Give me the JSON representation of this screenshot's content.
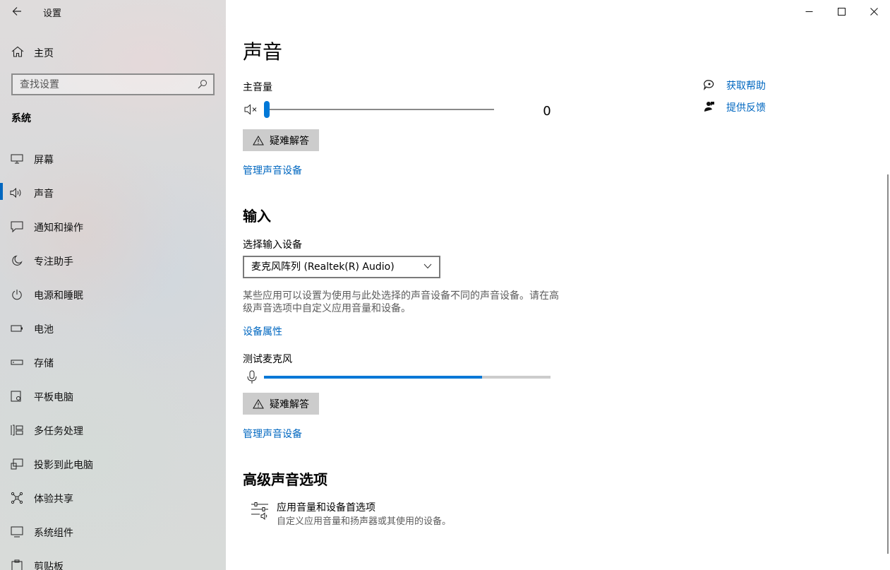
{
  "window": {
    "app_title": "设置",
    "back_icon": "back-arrow-icon",
    "controls": [
      "minimize-icon",
      "maximize-icon",
      "close-icon"
    ]
  },
  "sidebar": {
    "home_label": "主页",
    "search_placeholder": "查找设置",
    "section_label": "系统",
    "items": [
      {
        "label": "屏幕",
        "icon": "monitor-icon"
      },
      {
        "label": "声音",
        "icon": "speaker-icon",
        "active": true
      },
      {
        "label": "通知和操作",
        "icon": "notification-icon"
      },
      {
        "label": "专注助手",
        "icon": "moon-icon"
      },
      {
        "label": "电源和睡眠",
        "icon": "power-icon"
      },
      {
        "label": "电池",
        "icon": "battery-icon"
      },
      {
        "label": "存储",
        "icon": "storage-icon"
      },
      {
        "label": "平板电脑",
        "icon": "tablet-icon"
      },
      {
        "label": "多任务处理",
        "icon": "multitask-icon"
      },
      {
        "label": "投影到此电脑",
        "icon": "project-icon"
      },
      {
        "label": "体验共享",
        "icon": "share-icon"
      },
      {
        "label": "系统组件",
        "icon": "components-icon"
      },
      {
        "label": "剪贴板",
        "icon": "clipboard-icon"
      }
    ],
    "accent_color": "#0067c0"
  },
  "main": {
    "title": "声音",
    "output": {
      "master_volume_label": "主音量",
      "volume_value": "0",
      "volume_level": 0,
      "troubleshoot_label": "疑难解答",
      "manage_devices_link": "管理声音设备"
    },
    "input": {
      "heading": "输入",
      "select_device_label": "选择输入设备",
      "selected_device": "麦克风阵列 (Realtek(R) Audio)",
      "description": "某些应用可以设置为使用与此处选择的声音设备不同的声音设备。请在高级声音选项中自定义应用音量和设备。",
      "device_properties_link": "设备属性",
      "test_mic_label": "测试麦克风",
      "mic_level": 0.76,
      "troubleshoot_label": "疑难解答",
      "manage_devices_link": "管理声音设备"
    },
    "advanced": {
      "heading": "高级声音选项",
      "app_volume_title": "应用音量和设备首选项",
      "app_volume_subtitle": "自定义应用音量和扬声器或其使用的设备。"
    },
    "side_links": {
      "get_help": "获取帮助",
      "give_feedback": "提供反馈"
    },
    "link_color": "#0067c0",
    "slider_color": "#0078d7"
  }
}
